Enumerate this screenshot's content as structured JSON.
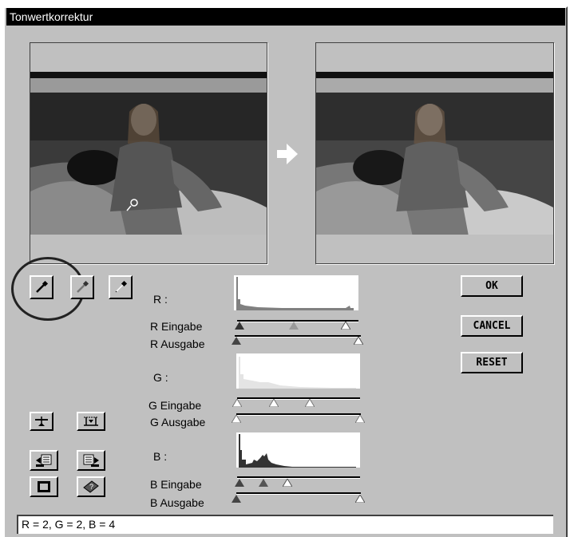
{
  "window": {
    "title": "Tonwertkorrektur"
  },
  "channels": [
    {
      "key": "R",
      "label": "R :",
      "input_label": "R Eingabe",
      "output_label": "R Ausgabe"
    },
    {
      "key": "G",
      "label": "G :",
      "input_label": "G Eingabe",
      "output_label": "G Ausgabe"
    },
    {
      "key": "B",
      "label": "B :",
      "input_label": "B Eingabe",
      "output_label": "B Ausgabe"
    }
  ],
  "buttons": {
    "ok": "OK",
    "cancel": "CANCEL",
    "reset": "RESET"
  },
  "status": {
    "text": "R = 2, G = 2, B = 4"
  },
  "icons": {
    "eyedropper_black": "eyedropper-icon",
    "eyedropper_gray": "eyedropper-gray-icon",
    "eyedropper_white": "eyedropper-white-icon",
    "arrow": "right-arrow-icon"
  }
}
